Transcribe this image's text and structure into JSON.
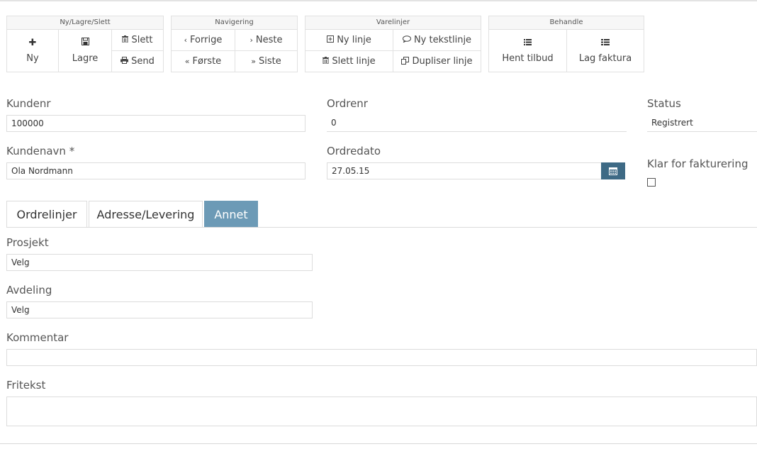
{
  "toolbar": {
    "groups": {
      "ny_lagre_slett": {
        "title": "Ny/Lagre/Slett",
        "ny": "Ny",
        "lagre": "Lagre",
        "slett": "Slett",
        "send": "Send"
      },
      "navigering": {
        "title": "Navigering",
        "forrige": "Forrige",
        "neste": "Neste",
        "forste": "Første",
        "siste": "Siste"
      },
      "varelinjer": {
        "title": "Varelinjer",
        "ny_linje": "Ny linje",
        "ny_tekstlinje": "Ny tekstlinje",
        "slett_linje": "Slett linje",
        "dupliser_linje": "Dupliser linje"
      },
      "behandle": {
        "title": "Behandle",
        "hent_tilbud": "Hent tilbud",
        "lag_faktura": "Lag faktura"
      }
    }
  },
  "form": {
    "kundenr": {
      "label": "Kundenr",
      "value": "100000"
    },
    "kundenavn": {
      "label": "Kundenavn *",
      "value": "Ola Nordmann"
    },
    "ordrenr": {
      "label": "Ordrenr",
      "value": "0"
    },
    "ordredato": {
      "label": "Ordredato",
      "value": "27.05.15"
    },
    "status": {
      "label": "Status",
      "value": "Registrert"
    },
    "klar": {
      "label": "Klar for fakturering",
      "checked": false
    }
  },
  "tabs": [
    {
      "label": "Ordrelinjer",
      "active": false
    },
    {
      "label": "Adresse/Levering",
      "active": false
    },
    {
      "label": "Annet",
      "active": true
    }
  ],
  "annet": {
    "prosjekt": {
      "label": "Prosjekt",
      "value": "Velg"
    },
    "avdeling": {
      "label": "Avdeling",
      "value": "Velg"
    },
    "kommentar": {
      "label": "Kommentar",
      "value": ""
    },
    "fritekst": {
      "label": "Fritekst",
      "value": ""
    }
  },
  "colors": {
    "accent": "#6c9ab6",
    "calendar_button": "#3e6a85"
  }
}
